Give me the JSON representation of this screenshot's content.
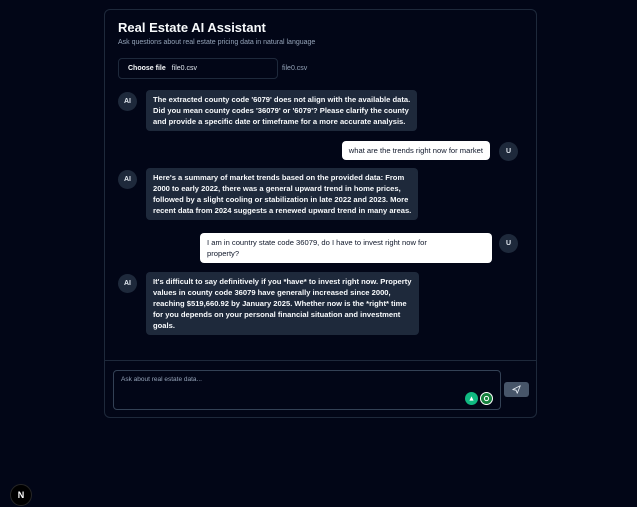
{
  "header": {
    "title": "Real Estate AI Assistant",
    "subtitle": "Ask questions about real estate pricing data in natural language"
  },
  "file_upload": {
    "button_label": "Choose file",
    "selected_file": "file0.csv",
    "file_tag": "file0.csv"
  },
  "avatars": {
    "ai": "AI",
    "user": "U"
  },
  "messages": [
    {
      "role": "ai",
      "lines": [
        "The extracted county code '6079' does not align with the available data.",
        "Did you mean county codes '36079' or '6079'? Please clarify the county",
        "and provide a specific date or timeframe for a more accurate analysis."
      ]
    },
    {
      "role": "user",
      "lines": [
        "what are the trends right now for market"
      ]
    },
    {
      "role": "ai",
      "lines": [
        "Here's a summary of market trends based on the provided data: From",
        "2000 to early 2022, there was a general upward trend in home prices,",
        "followed by a slight cooling or stabilization in late 2022 and 2023. More",
        "recent data from 2024 suggests a renewed upward trend in many areas."
      ]
    },
    {
      "role": "user",
      "lines": [
        "I am in country state code 36079, do I have to invest right now for",
        "property?"
      ]
    },
    {
      "role": "ai",
      "lines": [
        "It's difficult to say definitively if you *have* to invest right now. Property",
        "values in county code 36079 have generally increased since 2000,",
        "reaching $519,660.92 by January 2025. Whether now is the *right* time",
        "for you depends on your personal financial situation and investment",
        "goals."
      ]
    }
  ],
  "composer": {
    "placeholder": "Ask about real estate data..."
  },
  "next_badge": "N",
  "colors": {
    "background": "#020617",
    "ai_bubble": "#1e293b",
    "user_bubble": "#ffffff",
    "grammar_tool_1": "#10b981",
    "grammar_tool_2": "#15803d",
    "send_button": "#475569"
  },
  "icons": {
    "send": "send-icon",
    "tool_1": "writing-assistant-icon",
    "tool_2": "grammar-check-icon"
  }
}
